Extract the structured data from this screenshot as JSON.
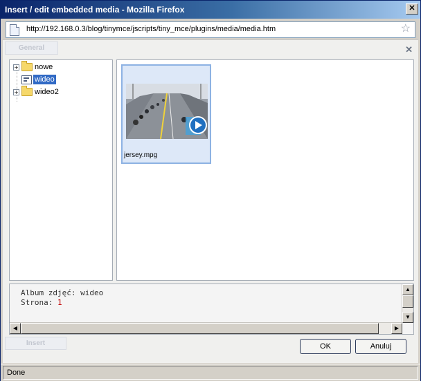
{
  "window": {
    "title": "Insert / edit embedded media - Mozilla Firefox",
    "close_glyph": "✕",
    "url": "http://192.168.0.3/blog/tinymce/jscripts/tiny_mce/plugins/media/media.htm",
    "star_glyph": "☆"
  },
  "dialog": {
    "tab_label": "General",
    "insert_label": "Insert",
    "close_glyph": "✕"
  },
  "tree": {
    "items": [
      {
        "label": "nowe",
        "expander": "+",
        "icon": "folder-icon",
        "selected": false
      },
      {
        "label": "wideo",
        "expander": "",
        "icon": "album-icon",
        "selected": true
      },
      {
        "label": "wideo2",
        "expander": "+",
        "icon": "folder-icon",
        "selected": false
      }
    ]
  },
  "files": [
    {
      "name": "jersey.mpg",
      "icon": "play-icon"
    }
  ],
  "info": {
    "album_label": "Album zdjęć:",
    "album_value": "wideo",
    "page_label": "Strona:",
    "page_value": "1"
  },
  "buttons": {
    "ok": "OK",
    "cancel": "Anuluj"
  },
  "status": {
    "text": "Done"
  },
  "colors": {
    "selection": "#316ac5",
    "page_number": "#c00000",
    "thumb_border": "#8db2e3"
  }
}
